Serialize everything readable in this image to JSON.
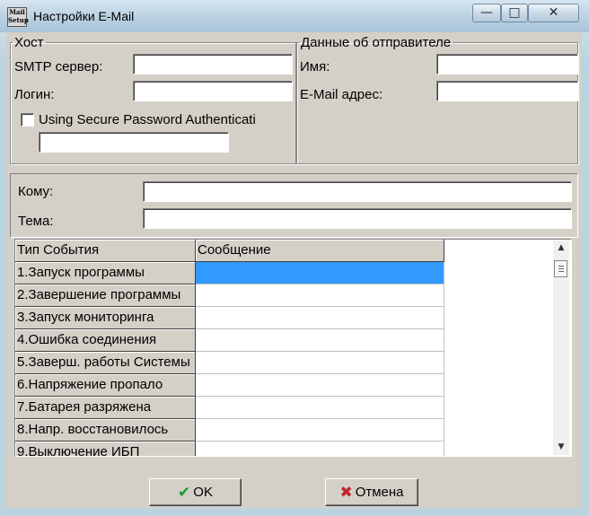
{
  "window": {
    "title": "Настройки E-Mail",
    "icon_text": "Mail Setup",
    "minimize_glyph": "—",
    "maximize_glyph": "□",
    "close_glyph": "✕"
  },
  "host_group": {
    "legend": "Хост",
    "smtp_label": "SMTP сервер:",
    "smtp_value": "",
    "login_label": "Логин:",
    "login_value": "",
    "spa_label": "Using Secure Password Authenticati",
    "spa_checked": false,
    "password_value": ""
  },
  "sender_group": {
    "legend": "Данные об отправителе",
    "name_label": "Имя:",
    "name_value": "",
    "email_label": "E-Mail адрес:",
    "email_value": ""
  },
  "recipient": {
    "to_label": "Кому:",
    "to_value": "",
    "subject_label": "Тема:",
    "subject_value": ""
  },
  "events_grid": {
    "columns": [
      "Тип События",
      "Сообщение"
    ],
    "rows": [
      {
        "event": "1.Запуск программы",
        "message": ""
      },
      {
        "event": "2.Завершение программы",
        "message": ""
      },
      {
        "event": "3.Запуск мониторинга",
        "message": ""
      },
      {
        "event": "4.Ошибка соединения",
        "message": ""
      },
      {
        "event": "5.Заверш. работы Системы",
        "message": ""
      },
      {
        "event": "6.Напряжение пропало",
        "message": ""
      },
      {
        "event": "7.Батарея разряжена",
        "message": ""
      },
      {
        "event": "8.Напр. восстановилось",
        "message": ""
      },
      {
        "event": "9.Выключение ИБП",
        "message": ""
      }
    ],
    "selected_row": 1
  },
  "buttons": {
    "ok_label": "OK",
    "ok_icon": "check-icon",
    "cancel_label": "Отмена",
    "cancel_icon": "cross-icon"
  },
  "colors": {
    "ok_icon": "#1e9a2e",
    "cancel_icon": "#c0272d",
    "selection": "#3399ff"
  }
}
